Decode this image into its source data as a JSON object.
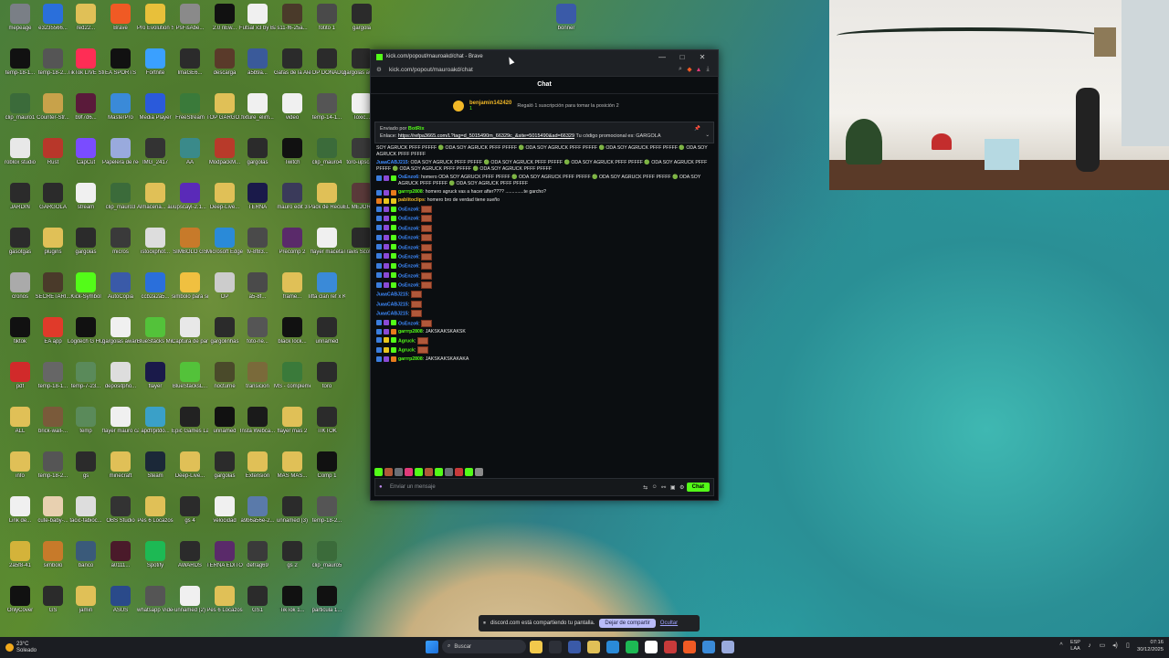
{
  "desktop_icons": [
    {
      "label": "mepeage",
      "color": "#7a7f86"
    },
    {
      "label": "temp-18-1...",
      "color": "#111111"
    },
    {
      "label": "clip_mauro1",
      "color": "#3b6b3a"
    },
    {
      "label": "roblox studio",
      "color": "#e8e8e8"
    },
    {
      "label": "JARDIN",
      "color": "#2b2b2b"
    },
    {
      "label": "gasotgas",
      "color": "#2b2b2b"
    },
    {
      "label": "cronos",
      "color": "#aaaaaa"
    },
    {
      "label": "tiktok",
      "color": "#111111"
    },
    {
      "label": "pdf",
      "color": "#d12a2a"
    },
    {
      "label": "ALL",
      "color": "#e0c057"
    },
    {
      "label": "info",
      "color": "#e0c057"
    },
    {
      "label": "Link de...",
      "color": "#f0f0f0"
    },
    {
      "label": "2a5f8-41",
      "color": "#d4b33a"
    },
    {
      "label": "OnlyCover",
      "color": "#111111"
    },
    {
      "label": "e3235566...",
      "color": "#2a6fdb"
    },
    {
      "label": "temp-18-2...",
      "color": "#555555"
    },
    {
      "label": "Counter-Str...",
      "color": "#c8a24a"
    },
    {
      "label": "Rust",
      "color": "#b8372a"
    },
    {
      "label": "GARGOLA",
      "color": "#2b2b2b"
    },
    {
      "label": "plugins",
      "color": "#e0c057"
    },
    {
      "label": "SECRETARI...",
      "color": "#4a3a2a"
    },
    {
      "label": "EA app",
      "color": "#e03a2a"
    },
    {
      "label": "temp-18-1...",
      "color": "#666666"
    },
    {
      "label": "brick-wall-...",
      "color": "#7a5a3a"
    },
    {
      "label": "temp-18-2...",
      "color": "#555555"
    },
    {
      "label": "cute-baby-...",
      "color": "#e8d0b0"
    },
    {
      "label": "simbolo",
      "color": "#c77a2a"
    },
    {
      "label": "GS",
      "color": "#2b2b2b"
    },
    {
      "label": "red22...",
      "color": "#e0c057"
    },
    {
      "label": "TikTok LIVE Studio",
      "color": "#ff2d55"
    },
    {
      "label": "b9f7d6...",
      "color": "#5a1a3a"
    },
    {
      "label": "CapCut",
      "color": "#7a4cff"
    },
    {
      "label": "stream",
      "color": "#f0f0f0"
    },
    {
      "label": "gargolas",
      "color": "#2b2b2b"
    },
    {
      "label": "Kick-Symbol",
      "color": "#53fc18"
    },
    {
      "label": "Logitech G HUB",
      "color": "#111111"
    },
    {
      "label": "temp-7-23...",
      "color": "#5a8a5a"
    },
    {
      "label": "temp",
      "color": "#5a8a5a"
    },
    {
      "label": "gs",
      "color": "#2b2b2b"
    },
    {
      "label": "tacic-fabioc...",
      "color": "#dddddd"
    },
    {
      "label": "banco",
      "color": "#3a5a7a"
    },
    {
      "label": "jamin",
      "color": "#e0c057"
    },
    {
      "label": "Brave",
      "color": "#f05a24"
    },
    {
      "label": "EA SPORTS",
      "color": "#111111"
    },
    {
      "label": "MasterPro",
      "color": "#3a8ad8"
    },
    {
      "label": "Papelera de recicl...",
      "color": "#9ad"
    },
    {
      "label": "clip_mauro3",
      "color": "#3b6b3a"
    },
    {
      "label": "micros",
      "color": "#3a3a3a"
    },
    {
      "label": "AutoCopia",
      "color": "#3a5aa8"
    },
    {
      "label": "gargolas awards",
      "color": "#f0f0f0"
    },
    {
      "label": "depositpho...",
      "color": "#dddddd"
    },
    {
      "label": "flayer mauro caliente",
      "color": "#f0f0f0"
    },
    {
      "label": "minecraft",
      "color": "#e0c057"
    },
    {
      "label": "OBS Studio",
      "color": "#333333"
    },
    {
      "label": "a0111...",
      "color": "#4a1a2a"
    },
    {
      "label": "ASUS",
      "color": "#2a4a8a"
    },
    {
      "label": "Pro Evolution Soccer 6",
      "color": "#e8c03a"
    },
    {
      "label": "Fortnite",
      "color": "#3aa0ff"
    },
    {
      "label": "Media Player",
      "color": "#2a5adb"
    },
    {
      "label": "IMG_2417",
      "color": "#333333"
    },
    {
      "label": "Almacena... automatic...",
      "color": "#e0c057"
    },
    {
      "label": "istockphot...",
      "color": "#dddddd"
    },
    {
      "label": "ccb2a2a5...",
      "color": "#2a6fdb"
    },
    {
      "label": "BlueStacks Multi-Insta...",
      "color": "#53c23a"
    },
    {
      "label": "flayer",
      "color": "#1a1a4a"
    },
    {
      "label": "apdf/pitdo...",
      "color": "#3aa0c8"
    },
    {
      "label": "Steam",
      "color": "#1b2838"
    },
    {
      "label": "Pes 6 Locazos",
      "color": "#e0c057"
    },
    {
      "label": "Spotify",
      "color": "#1db954"
    },
    {
      "label": "whatsapp Video 20...",
      "color": "#555555"
    },
    {
      "label": "PsFisAbe...",
      "color": "#8a8a8a"
    },
    {
      "label": "ImaGE6...",
      "color": "#2b2b2b"
    },
    {
      "label": "FreeStream",
      "color": "#3a7a3a"
    },
    {
      "label": "AA",
      "color": "#3a8a8a"
    },
    {
      "label": "upscayl-2.1...",
      "color": "#5a2ab8"
    },
    {
      "label": "SIMBOLO GS",
      "color": "#c77a2a"
    },
    {
      "label": "simbolo para sin fondo",
      "color": "#f0c040"
    },
    {
      "label": "Captura de pantalla...",
      "color": "#e8e8e8"
    },
    {
      "label": "BlueStacksL...",
      "color": "#53c23a"
    },
    {
      "label": "Epic Games Launcher",
      "color": "#222222"
    },
    {
      "label": "Deep-Live...",
      "color": "#e0c057"
    },
    {
      "label": "gs 4",
      "color": "#2b2b2b"
    },
    {
      "label": "AWARDS",
      "color": "#2b2b2b"
    },
    {
      "label": "unnamed (2)",
      "color": "#f0f0f0"
    },
    {
      "label": "2.0 nEw...",
      "color": "#111111"
    },
    {
      "label": "descarga",
      "color": "#5a3a2a"
    },
    {
      "label": "TOP GARGO...",
      "color": "#e0c057"
    },
    {
      "label": "ModpackM...",
      "color": "#b83a2a"
    },
    {
      "label": "Deep-Live...",
      "color": "#e0c057"
    },
    {
      "label": "Microsoft Edge",
      "color": "#2a8ad8"
    },
    {
      "label": "OP",
      "color": "#cccccc"
    },
    {
      "label": "gargolinhas",
      "color": "#2b2b2b"
    },
    {
      "label": "nocturne",
      "color": "#4a4a2a"
    },
    {
      "label": "unnamed",
      "color": "#111111"
    },
    {
      "label": "gargolas",
      "color": "#2b2b2b"
    },
    {
      "label": "velocidad",
      "color": "#f0f0f0"
    },
    {
      "label": "TERNA EDITOR",
      "color": "#5a2a6a"
    },
    {
      "label": "Pes 6 Locazos",
      "color": "#e0c057"
    },
    {
      "label": "Futsal x3 by Batinga Fra...",
      "color": "#f0f0f0"
    },
    {
      "label": "a5b9a...",
      "color": "#3a5a9a"
    },
    {
      "label": "fixture_elim...",
      "color": "#f0f0f0"
    },
    {
      "label": "gargolas",
      "color": "#2b2b2b"
    },
    {
      "label": "TERNA",
      "color": "#1a1a4a"
    },
    {
      "label": "tv-8f83...",
      "color": "#4a4a4a"
    },
    {
      "label": "a5-8f...",
      "color": "#4a4a4a"
    },
    {
      "label": "foto-ne...",
      "color": "#555555"
    },
    {
      "label": "transicion",
      "color": "#7a6a3a"
    },
    {
      "label": "Insta Webca...",
      "color": "#1a1a1a"
    },
    {
      "label": "Extension",
      "color": "#e0c057"
    },
    {
      "label": "a9b6a56e-2...",
      "color": "#5a7aaa"
    },
    {
      "label": "defrag69",
      "color": "#3a3a3a"
    },
    {
      "label": "GS1",
      "color": "#2b2b2b"
    },
    {
      "label": "s11-f6-25a...",
      "color": "#4a3a2a"
    },
    {
      "label": "Gafas de la Aleman...",
      "color": "#2b2b2b"
    },
    {
      "label": "video",
      "color": "#f0f0f0"
    },
    {
      "label": "Twitch",
      "color": "#111111"
    },
    {
      "label": "mauro edit 3",
      "color": "#3a3a5a"
    },
    {
      "label": "Precomp 2",
      "color": "#5a2a6a"
    },
    {
      "label": "frame...",
      "color": "#e0c057"
    },
    {
      "label": "black lock...",
      "color": "#111111"
    },
    {
      "label": "MS - complemento",
      "color": "#3a7a3a"
    },
    {
      "label": "flayer mas 2",
      "color": "#e0c057"
    },
    {
      "label": "MAS MAS...",
      "color": "#e0c057"
    },
    {
      "label": "unnamed (3)",
      "color": "#2b2b2b"
    },
    {
      "label": "gs 2",
      "color": "#2b2b2b"
    },
    {
      "label": "TikTok 1...",
      "color": "#111111"
    },
    {
      "label": "fotito 1",
      "color": "#4a4a4a"
    },
    {
      "label": "TOP DONADOR...",
      "color": "#2b2b2b"
    },
    {
      "label": "temp-14-1...",
      "color": "#555555"
    },
    {
      "label": "clip_mauro4",
      "color": "#3b6b3a"
    },
    {
      "label": "Pack de Recursos",
      "color": "#e0c057"
    },
    {
      "label": "flayer maceta",
      "color": "#f0f0f0"
    },
    {
      "label": "lifta clan ref x Kick mauro...",
      "color": "#3a8ad8"
    },
    {
      "label": "unnamed",
      "color": "#2b2b2b"
    },
    {
      "label": "toro",
      "color": "#2b2b2b"
    },
    {
      "label": "TIKTOK",
      "color": "#2b2b2b"
    },
    {
      "label": "Comp 1",
      "color": "#111111"
    },
    {
      "label": "temp-18-2...",
      "color": "#555555"
    },
    {
      "label": "clip_mauro5",
      "color": "#3b6b3a"
    },
    {
      "label": "particula 1...",
      "color": "#111111"
    },
    {
      "label": "gargola",
      "color": "#2b2b2b"
    },
    {
      "label": "gargolas awards",
      "color": "#2b2b2b"
    },
    {
      "label": "Toxic...",
      "color": "#f0f0f0"
    },
    {
      "label": "toro-upsca...",
      "color": "#3a3a3a"
    },
    {
      "label": "EL MEJOR PHONK",
      "color": "#5a3a3a"
    },
    {
      "label": "Travis Scott - Sicko Mode",
      "color": "#2a2a2a"
    },
    {
      "label": "bonner",
      "color": "#3a5aa8"
    }
  ],
  "browser": {
    "title": "kick.com/popout/mauroakd/chat - Brave",
    "url": "kick.com/popout/mauroakd/chat",
    "controls": {
      "minimize": "—",
      "maximize": "□",
      "close": "✕"
    }
  },
  "chat": {
    "header": "Chat",
    "gift": {
      "user": "benjamin142420",
      "count": "1",
      "text": "Regaló 1 suscripción para tomar la posición 2"
    },
    "pinned": {
      "sent_by_label": "Enviado por",
      "sender": "BotRix",
      "prefix": "Enlace:",
      "link": "https://refpa3665.com/L?tag=d_5015490m_66329c_&site=5015490&ad=66329",
      "suffix": "Tu código promocional es: GARGOLA"
    },
    "messages": [
      {
        "user": "",
        "text": "SOY AGRUCK PFFF PFFFF 🟢 ODA SOY AGRUCK PFFF PFFFF 🟢 ODA SOY AGRUCK PFFF PFFFF 🟢 ODA SOY AGRUCK PFFF PFFFF 🟢 ODA SOY AGRUCK PFFF PFFFF",
        "badges": [],
        "ucls": "uname-blue"
      },
      {
        "user": "JuaaCABJ215",
        "text": "ODA SOY AGRUCK PFFF PFFFF 🟢 ODA SOY AGRUCK PFFF PFFFF 🟢 ODA SOY AGRUCK PFFF PFFFF 🟢 ODA SOY AGRUCK PFFF PFFFF 🟢 ODA SOY AGRUCK PFFF PFFFF 🟢 ODA SOY AGRUCK PFFF PFFFF",
        "badges": [],
        "ucls": "uname-blue"
      },
      {
        "user": "OsEnzo6",
        "text": "homero ODA SOY AGRUCK PFFF PFFFF 🟢 ODA SOY AGRUCK PFFF PFFFF 🟢 ODA SOY AGRUCK PFFF PFFFF 🟢 ODA SOY AGRUCK PFFF PFFFF 🟢 ODA SOY AGRUCK PFFF PFFFF",
        "badges": [
          "b-blue",
          "b-purple",
          "b-green"
        ],
        "ucls": "uname-blue"
      },
      {
        "user": "garrrp2808",
        "text": "homero agruck vas a hacer after???? ..............te garcho?",
        "badges": [
          "b-blue",
          "b-purple",
          "b-orange"
        ],
        "ucls": "uname-green"
      },
      {
        "user": "pablitoclips",
        "text": "homero bro de verdad tiene sueño",
        "badges": [
          "b-orange",
          "b-yellow",
          "b-yellow"
        ],
        "ucls": "uname-orange"
      },
      {
        "user": "OsEnzo6",
        "text": "",
        "emote": true,
        "badges": [
          "b-blue",
          "b-purple",
          "b-green"
        ],
        "ucls": "uname-blue"
      },
      {
        "user": "OsEnzo6",
        "text": "",
        "emote": true,
        "badges": [
          "b-blue",
          "b-purple",
          "b-green"
        ],
        "ucls": "uname-blue"
      },
      {
        "user": "OsEnzo6",
        "text": "",
        "emote": true,
        "badges": [
          "b-blue",
          "b-purple",
          "b-green"
        ],
        "ucls": "uname-blue"
      },
      {
        "user": "OsEnzo6",
        "text": "",
        "emote": true,
        "badges": [
          "b-blue",
          "b-purple",
          "b-green"
        ],
        "ucls": "uname-blue"
      },
      {
        "user": "OsEnzo6",
        "text": "",
        "emote": true,
        "badges": [
          "b-blue",
          "b-purple",
          "b-green"
        ],
        "ucls": "uname-blue"
      },
      {
        "user": "OsEnzo6",
        "text": "",
        "emote": true,
        "badges": [
          "b-blue",
          "b-purple",
          "b-green"
        ],
        "ucls": "uname-blue"
      },
      {
        "user": "OsEnzo6",
        "text": "",
        "emote": true,
        "badges": [
          "b-blue",
          "b-purple",
          "b-green"
        ],
        "ucls": "uname-blue"
      },
      {
        "user": "OsEnzo6",
        "text": "",
        "emote": true,
        "badges": [
          "b-blue",
          "b-purple",
          "b-green"
        ],
        "ucls": "uname-blue"
      },
      {
        "user": "OsEnzo6",
        "text": "",
        "emote": true,
        "badges": [
          "b-blue",
          "b-purple",
          "b-green"
        ],
        "ucls": "uname-blue"
      },
      {
        "user": "JuaaCABJ215",
        "text": "",
        "emote": true,
        "badges": [],
        "ucls": "uname-blue"
      },
      {
        "user": "JuaaCABJ215",
        "text": "",
        "emote": true,
        "badges": [],
        "ucls": "uname-blue"
      },
      {
        "user": "JuaaCABJ215",
        "text": "",
        "emote": true,
        "badges": [],
        "ucls": "uname-blue"
      },
      {
        "user": "OsEnzo6",
        "text": "",
        "emote": true,
        "badges": [
          "b-blue",
          "b-purple",
          "b-green"
        ],
        "ucls": "uname-blue"
      },
      {
        "user": "garrrp2808",
        "text": "JAKSKAKSKAKSK",
        "badges": [
          "b-blue",
          "b-purple",
          "b-orange"
        ],
        "ucls": "uname-green"
      },
      {
        "user": "Agruck",
        "text": "",
        "emote": true,
        "badges": [
          "b-blue",
          "b-yellow",
          "b-green"
        ],
        "ucls": "uname-green"
      },
      {
        "user": "Agruck",
        "text": "",
        "emote": true,
        "badges": [
          "b-blue",
          "b-yellow",
          "b-green"
        ],
        "ucls": "uname-green"
      },
      {
        "user": "garrrp2808",
        "text": "JAKSKAKSKAKAKA",
        "badges": [
          "b-blue",
          "b-purple",
          "b-orange"
        ],
        "ucls": "uname-green"
      }
    ],
    "composer": {
      "placeholder": "Enviar un mensaje",
      "send_label": "Chat"
    }
  },
  "share_bar": {
    "text": "discord.com está compartiendo tu pantalla.",
    "stop_label": "Dejar de compartir",
    "hide_label": "Ocultar"
  },
  "taskbar": {
    "weather": {
      "temp": "23°C",
      "condition": "Soleado"
    },
    "search_label": "Buscar",
    "apps": [
      "#f2c94c",
      "#2d3038",
      "#3a5aa8",
      "#e0c057",
      "#2a8ad8",
      "#1db954",
      "#ffffff",
      "#c83a3a",
      "#f05a24",
      "#3a8ad8",
      "#9ad"
    ],
    "lang": {
      "top": "ESP",
      "bottom": "LAA"
    },
    "clock": {
      "time": "07:16",
      "date": "30/12/2025"
    }
  },
  "colors": {
    "kick_green": "#53fc18",
    "brave_orange": "#f05a24"
  }
}
